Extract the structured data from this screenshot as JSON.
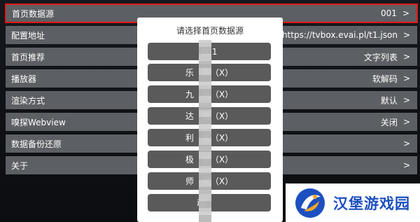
{
  "settings": {
    "rows": [
      {
        "label": "首页数据源",
        "value": "001"
      },
      {
        "label": "配置地址",
        "value": "https://tvbox.evai.pl/t1.json"
      },
      {
        "label": "首页推荐",
        "value": "文字列表"
      },
      {
        "label": "播放器",
        "value": "软解码"
      },
      {
        "label": "渲染方式",
        "value": "默认"
      },
      {
        "label": "嗅探Webview",
        "value": "关闭"
      },
      {
        "label": "数据备份还原",
        "value": ""
      },
      {
        "label": "关于",
        "value": ""
      }
    ],
    "chevron": ">"
  },
  "dialog": {
    "title": "请选择首页数据源",
    "options": [
      "001",
      "乐　视（X）",
      "九　马（X）",
      "达　视（X）",
      "利　视（X）",
      "极　视（X）",
      "师　视（X）",
      "动　　"
    ]
  },
  "watermark": {
    "text": "汉堡游戏园"
  },
  "colors": {
    "row_bg": "#5c5f63",
    "selected_outline": "#e31818",
    "dialog_bg": "#ffffff",
    "option_bg": "#5a5a5a",
    "watermark_text": "#1c4fbf"
  }
}
